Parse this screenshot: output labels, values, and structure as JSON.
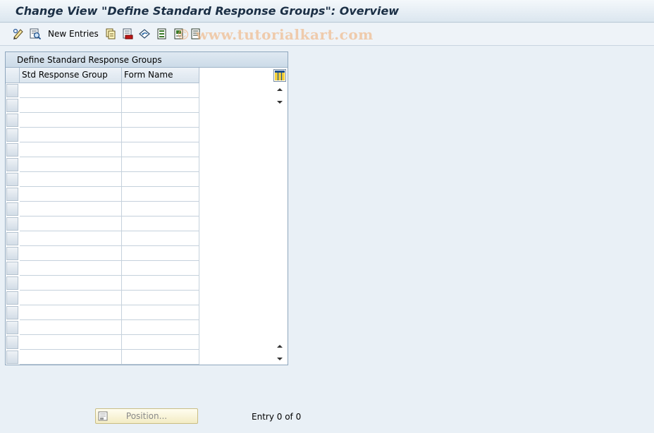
{
  "window": {
    "title": "Change View \"Define Standard Response Groups\": Overview"
  },
  "toolbar": {
    "new_entries_label": "New Entries",
    "watermark": "© www.tutorialkart.com",
    "icons": [
      "display-change-icon",
      "details-icon",
      "copy-icon",
      "delete-icon",
      "undo-icon",
      "select-all-icon",
      "select-block-icon",
      "deselect-all-icon"
    ]
  },
  "table": {
    "caption": "Define Standard Response Groups",
    "columns": [
      "Std Response Group",
      "Form Name"
    ],
    "rows": [
      [
        "",
        ""
      ],
      [
        "",
        ""
      ],
      [
        "",
        ""
      ],
      [
        "",
        ""
      ],
      [
        "",
        ""
      ],
      [
        "",
        ""
      ],
      [
        "",
        ""
      ],
      [
        "",
        ""
      ],
      [
        "",
        ""
      ],
      [
        "",
        ""
      ],
      [
        "",
        ""
      ],
      [
        "",
        ""
      ],
      [
        "",
        ""
      ],
      [
        "",
        ""
      ],
      [
        "",
        ""
      ],
      [
        "",
        ""
      ],
      [
        "",
        ""
      ],
      [
        "",
        ""
      ],
      [
        "",
        ""
      ]
    ]
  },
  "footer": {
    "position_label": "Position...",
    "entry_info": "Entry 0 of 0"
  },
  "colors": {
    "background": "#e9f0f6",
    "title_text": "#1b2f45",
    "button_face": "#f3ecc4"
  }
}
